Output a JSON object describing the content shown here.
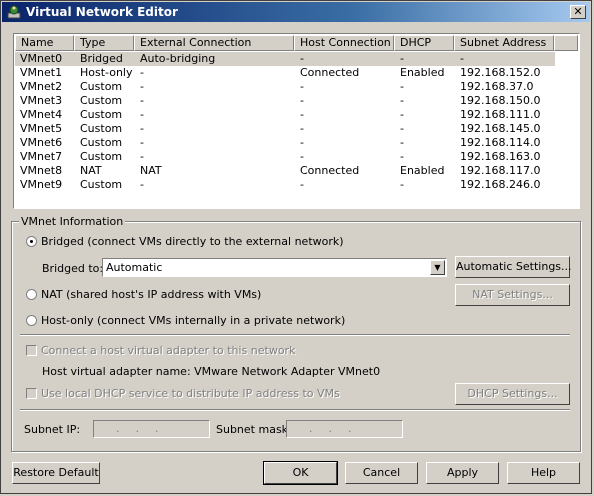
{
  "window": {
    "title": "Virtual Network Editor",
    "close_glyph": "✕"
  },
  "columns": [
    "Name",
    "Type",
    "External Connection",
    "Host Connection",
    "DHCP",
    "Subnet Address"
  ],
  "networks": [
    [
      "VMnet0",
      "Bridged",
      "Auto-bridging",
      "-",
      "-",
      "-"
    ],
    [
      "VMnet1",
      "Host-only",
      "-",
      "Connected",
      "Enabled",
      "192.168.152.0"
    ],
    [
      "VMnet2",
      "Custom",
      "-",
      "-",
      "-",
      "192.168.37.0"
    ],
    [
      "VMnet3",
      "Custom",
      "-",
      "-",
      "-",
      "192.168.150.0"
    ],
    [
      "VMnet4",
      "Custom",
      "-",
      "-",
      "-",
      "192.168.111.0"
    ],
    [
      "VMnet5",
      "Custom",
      "-",
      "-",
      "-",
      "192.168.145.0"
    ],
    [
      "VMnet6",
      "Custom",
      "-",
      "-",
      "-",
      "192.168.114.0"
    ],
    [
      "VMnet7",
      "Custom",
      "-",
      "-",
      "-",
      "192.168.163.0"
    ],
    [
      "VMnet8",
      "NAT",
      "NAT",
      "Connected",
      "Enabled",
      "192.168.117.0"
    ],
    [
      "VMnet9",
      "Custom",
      "-",
      "-",
      "-",
      "192.168.246.0"
    ]
  ],
  "vmnet_info": {
    "label": "VMnet Information",
    "bridged_radio": "Bridged (connect VMs directly to the external network)",
    "bridged_to_label": "Bridged to:",
    "bridged_to_value": "Automatic",
    "automatic_settings_btn": "Automatic Settings...",
    "nat_radio": "NAT (shared host's IP address with VMs)",
    "nat_settings_btn": "NAT Settings...",
    "hostonly_radio": "Host-only (connect VMs internally in a private network)",
    "connect_host_adapter": "Connect a host virtual adapter to this network",
    "host_adapter_name": "Host virtual adapter name: VMware Network Adapter VMnet0",
    "use_dhcp": "Use local DHCP service to distribute IP address to VMs",
    "dhcp_settings_btn": "DHCP Settings...",
    "subnet_ip_label": "Subnet IP:",
    "subnet_mask_label": "Subnet mask:",
    "ip_dots": "...",
    "mask_dots": "..."
  },
  "buttons": {
    "restore_default": "Restore Default",
    "ok": "OK",
    "cancel": "Cancel",
    "apply": "Apply",
    "help": "Help"
  }
}
